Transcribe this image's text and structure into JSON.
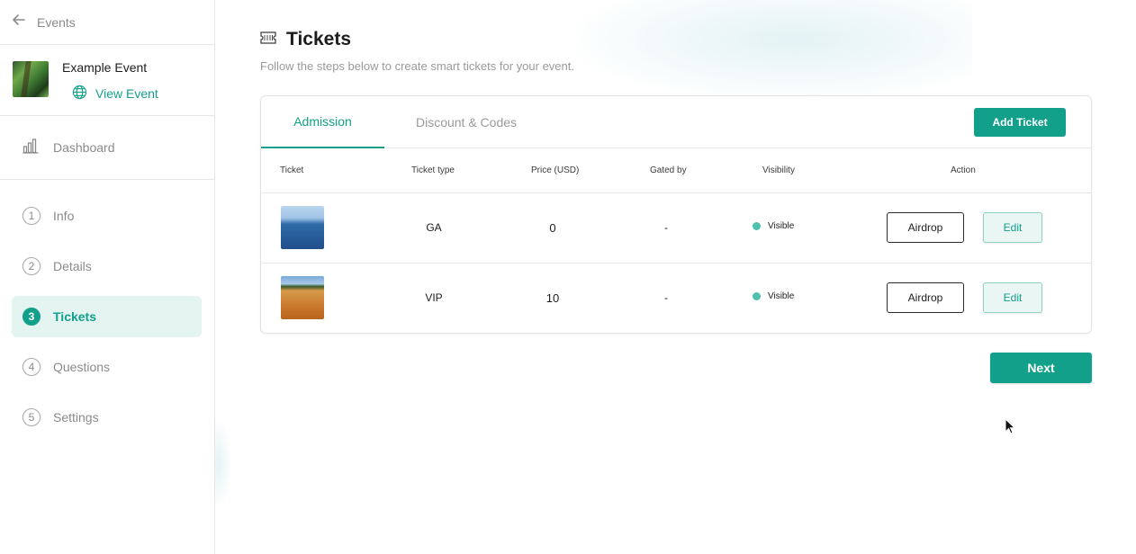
{
  "sidebar": {
    "back_label": "Events",
    "event_name": "Example Event",
    "view_event_label": "View Event",
    "dashboard_label": "Dashboard",
    "steps": [
      {
        "num": "1",
        "label": "Info",
        "active": false
      },
      {
        "num": "2",
        "label": "Details",
        "active": false
      },
      {
        "num": "3",
        "label": "Tickets",
        "active": true
      },
      {
        "num": "4",
        "label": "Questions",
        "active": false
      },
      {
        "num": "5",
        "label": "Settings",
        "active": false
      }
    ]
  },
  "main": {
    "title": "Tickets",
    "subtitle": "Follow the steps below to create smart tickets for your event.",
    "tabs": [
      {
        "label": "Admission",
        "active": true
      },
      {
        "label": "Discount & Codes",
        "active": false
      }
    ],
    "add_ticket_label": "Add Ticket",
    "table": {
      "headers": [
        "Ticket",
        "Ticket type",
        "Price (USD)",
        "Gated by",
        "Visibility",
        "Action"
      ],
      "rows": [
        {
          "image": "sea",
          "type": "GA",
          "price": "0",
          "gated_by": "-",
          "visibility": "Visible",
          "airdrop_label": "Airdrop",
          "edit_label": "Edit"
        },
        {
          "image": "desert",
          "type": "VIP",
          "price": "10",
          "gated_by": "-",
          "visibility": "Visible",
          "airdrop_label": "Airdrop",
          "edit_label": "Edit"
        }
      ]
    },
    "next_label": "Next"
  },
  "colors": {
    "accent": "#13a08b",
    "accent_light": "#e3f4f1",
    "visible_dot": "#4fc1ad"
  },
  "icons": {
    "back": "arrow-left-icon",
    "view_event": "globe-icon",
    "dashboard": "bar-chart-icon",
    "title": "ticket-icon"
  }
}
